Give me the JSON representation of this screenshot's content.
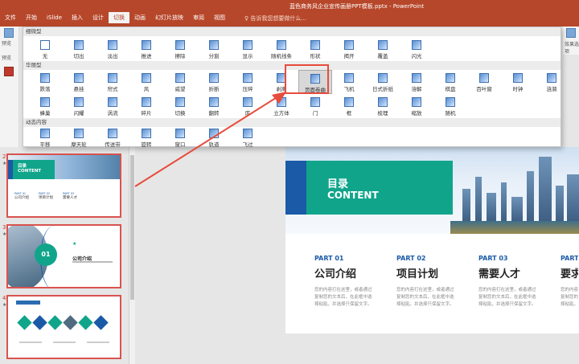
{
  "window": {
    "title": "蓝色商务风企业宣传画册PPT模板.pptx - PowerPoint"
  },
  "ribbon": {
    "tabs": [
      "文件",
      "开始",
      "iSlide",
      "插入",
      "设计",
      "切换",
      "动画",
      "幻灯片放映",
      "审阅",
      "视图"
    ],
    "active_tab": "切换",
    "search_hint": "♀ 告诉我您想要做什么...",
    "left_labels": [
      "预览",
      "预览"
    ],
    "right_label": "效果选项"
  },
  "gallery": {
    "sections": [
      {
        "title": "细微型",
        "items": [
          "无",
          "切出",
          "淡出",
          "推进",
          "擦除",
          "分割",
          "显示",
          "随机线条",
          "形状",
          "揭开",
          "覆盖",
          "闪光"
        ]
      },
      {
        "title": "华丽型",
        "rows": [
          [
            "跌落",
            "悬挂",
            "帘式",
            "风",
            "威望",
            "折断",
            "压碎",
            "剥离",
            "页面卷曲",
            "飞机",
            "日式折纸",
            "溶解",
            "棋盘",
            "百叶窗",
            "时钟",
            "涟漪"
          ],
          [
            "蜂巢",
            "闪耀",
            "涡流",
            "碎片",
            "切换",
            "翻转",
            "库",
            "立方体",
            "门",
            "框",
            "梳理",
            "缩放",
            "随机"
          ]
        ]
      },
      {
        "title": "动态内容",
        "items": [
          "平移",
          "摩天轮",
          "传送带",
          "旋转",
          "窗口",
          "轨道",
          "飞过"
        ]
      }
    ],
    "highlighted_item": "页面卷曲"
  },
  "thumbnails": [
    {
      "number": "2",
      "star": "★",
      "title1": "目录",
      "title2": "CONTENT",
      "cols": [
        {
          "part": "PART 01",
          "head": "公司介绍"
        },
        {
          "part": "PART 02",
          "head": "项目计划"
        },
        {
          "part": "PART 03",
          "head": "需要人才"
        }
      ]
    },
    {
      "number": "3",
      "star": "★",
      "circle": "01",
      "star_icon": "★",
      "sub": "公司介绍"
    },
    {
      "number": "4",
      "star": "★"
    }
  ],
  "slide": {
    "title1": "目录",
    "title2": "CONTENT",
    "cols": [
      {
        "part": "PART 01",
        "head": "公司介绍",
        "body": "您的内容打在这里，或者通过复制您的文本后，在此框中选择粘贴，并选择只保留文字。"
      },
      {
        "part": "PART 02",
        "head": "项目计划",
        "body": "您的内容打在这里，或者通过复制您的文本后，在此框中选择粘贴，并选择只保留文字。"
      },
      {
        "part": "PART 03",
        "head": "需要人才",
        "body": "您的内容打在这里，或者通过复制您的文本后，在此框中选择粘贴，并选择只保留文字。"
      },
      {
        "part": "PART",
        "head": "要求",
        "body": "您的内容打在这里，或者通过复制您的文本后，在此框中选择粘贴，并选择只保留文字。"
      }
    ]
  },
  "colors": {
    "ribbon": "#b7472a",
    "teal": "#10a58b",
    "blue": "#1a5aa7",
    "annotation": "#e74c3c"
  }
}
